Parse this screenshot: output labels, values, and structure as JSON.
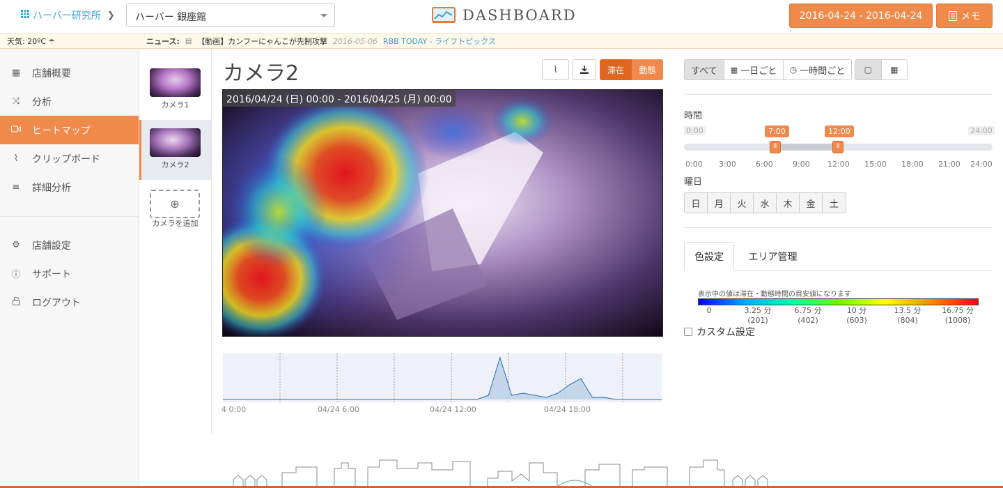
{
  "header": {
    "org_name": "ハーバー研究所",
    "store_select": "ハーバー 銀座館",
    "brand_title": "DASHBOARD",
    "date_range": "2016-04-24 - 2016-04-24",
    "memo_label": "メモ"
  },
  "news_bar": {
    "weather": "天気: 20ºC",
    "news_label": "ニュース:",
    "headline": "【動画】カンフーにゃんこが先制攻撃",
    "date": "2016-05-06",
    "source": "RBB TODAY - ライフトピックス"
  },
  "sidebar": {
    "items": [
      {
        "label": "店舗概要",
        "icon": "grid-icon"
      },
      {
        "label": "分析",
        "icon": "shuffle-icon"
      },
      {
        "label": "ヒートマップ",
        "icon": "video-icon"
      },
      {
        "label": "クリップボード",
        "icon": "paperclip-icon"
      },
      {
        "label": "詳細分析",
        "icon": "bars-icon"
      },
      {
        "label": "店舗設定",
        "icon": "gear-icon"
      },
      {
        "label": "サポート",
        "icon": "info-icon"
      },
      {
        "label": "ログアウト",
        "icon": "lock-icon"
      }
    ],
    "active_index": 2
  },
  "cameras": {
    "items": [
      {
        "label": "カメラ1"
      },
      {
        "label": "カメラ2"
      }
    ],
    "add_label": "カメラを追加",
    "selected_index": 1
  },
  "main": {
    "camera_title": "カメラ2",
    "mode_stay": "滞在",
    "mode_move": "動態",
    "heatmap_caption": "2016/04/24 (日) 00:00 - 2016/04/25 (月) 00:00",
    "timeline_labels": [
      "4 0:00",
      "04/24 6:00",
      "04/24 12:00",
      "04/24 18:00"
    ]
  },
  "filters": {
    "all": "すべて",
    "daily": "一日ごと",
    "hourly": "一時間ごと",
    "time_label": "時間",
    "range_start": "7:00",
    "range_end": "12:00",
    "min_label": "0:00",
    "max_label": "24:00",
    "ticks": [
      "0:00",
      "3:00",
      "6:00",
      "9:00",
      "12:00",
      "15:00",
      "18:00",
      "21:00",
      "24:00"
    ],
    "weekday_label": "曜日",
    "weekdays": [
      "日",
      "月",
      "火",
      "水",
      "木",
      "金",
      "土"
    ]
  },
  "color_panel": {
    "tab_color": "色設定",
    "tab_area": "エリア管理",
    "note": "表示中の値は滞在・動態時間の目安値になります",
    "scale": [
      {
        "v": "0",
        "c": ""
      },
      {
        "v": "3.25 分",
        "c": "(201)"
      },
      {
        "v": "6.75 分",
        "c": "(402)"
      },
      {
        "v": "10 分",
        "c": "(603)"
      },
      {
        "v": "13.5 分",
        "c": "(804)"
      },
      {
        "v": "16.75 分",
        "c": "(1008)"
      }
    ],
    "custom_label": "カスタム設定"
  },
  "timeline_series": [
    0,
    0,
    0,
    0,
    0,
    0,
    0,
    0,
    0,
    0,
    0,
    0,
    0,
    0,
    0,
    0,
    0,
    0,
    0,
    0,
    0,
    0,
    0,
    0.1,
    1.0,
    0.1,
    0.15,
    0.1,
    0.05,
    0.15,
    0.35,
    0.5,
    0.05,
    0.05,
    0,
    0,
    0,
    0,
    0
  ],
  "colors": {
    "accent": "#f08a4b",
    "accent_dark": "#e0661f",
    "link": "#3aa3d6"
  }
}
